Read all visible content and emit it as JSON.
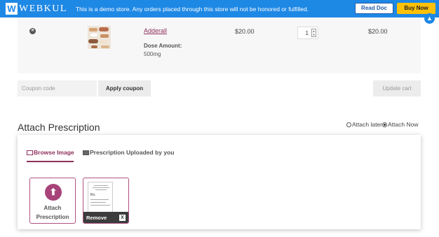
{
  "demo_bar": {
    "logo_mark": "W",
    "logo_text": "WEBKUL",
    "message": "This is a demo store. Any orders placed through this store will not be honored or fulfilled.",
    "read_doc_label": "Read Doc",
    "buy_now_label": "Buy Now",
    "accent": "#1e88e5"
  },
  "cart": {
    "item": {
      "name": "Adderall",
      "dose_label": "Dose Amount:",
      "dose_value": "500mg",
      "price": "$20.00",
      "quantity": "1",
      "subtotal": "$20.00"
    },
    "coupon_placeholder": "Coupon code",
    "apply_coupon_label": "Apply coupon",
    "update_cart_label": "Update cart"
  },
  "prescription": {
    "title": "Attach Prescription",
    "options": [
      {
        "label": "Attach later",
        "checked": false
      },
      {
        "label": "Attach Now",
        "checked": true
      }
    ],
    "tabs": [
      {
        "label": "Browse Image",
        "icon": "image-icon",
        "active": true
      },
      {
        "label": "Prescription Uploaded by you",
        "icon": "document-list-icon",
        "active": false
      }
    ],
    "attach_card_line1": "Attach",
    "attach_card_line2": "Prescription",
    "remove_label": "Remove",
    "remove_x": "X",
    "doc_rx": "Rx.",
    "brand_color": "#8e2f5c"
  }
}
